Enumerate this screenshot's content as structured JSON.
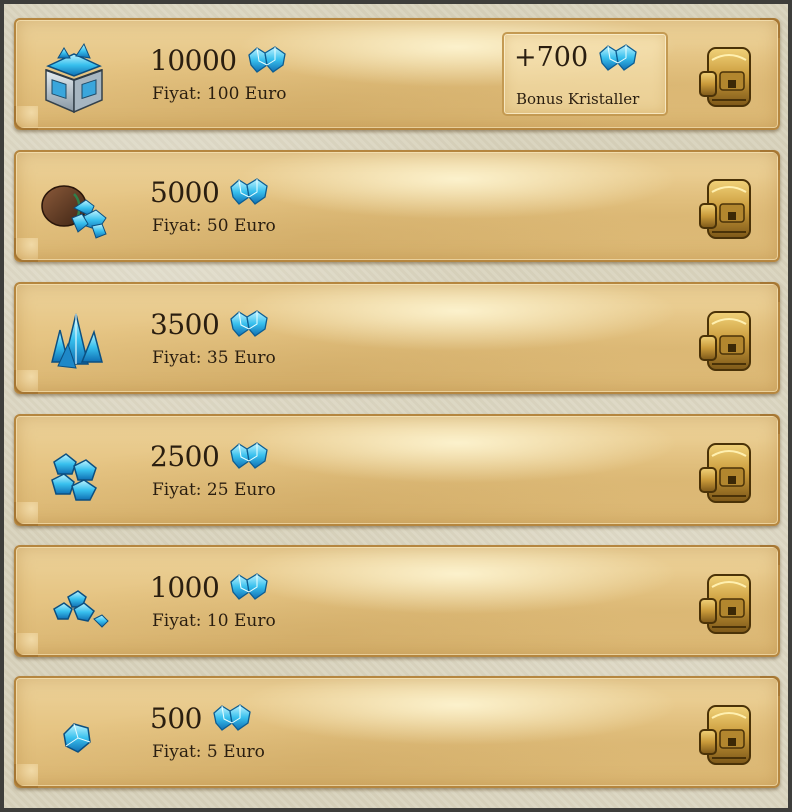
{
  "colors": {
    "panel": "#e6c584",
    "panel_border": "#b5863f",
    "text": "#2a1e10",
    "crystal": "#2aa8e8",
    "gold": "#c99a3a"
  },
  "currency_icon": "crystal-icon",
  "buy_icon": "gold-backpack-icon",
  "offers": [
    {
      "amount": "10000",
      "price": "Fiyat: 100 Euro",
      "item_icon": "treasure-chest-icon",
      "bonus": {
        "amount": "+700",
        "label": "Bonus Kristaller"
      }
    },
    {
      "amount": "5000",
      "price": "Fiyat: 50 Euro",
      "item_icon": "crystal-sack-icon"
    },
    {
      "amount": "3500",
      "price": "Fiyat: 35 Euro",
      "item_icon": "crystal-cluster-icon"
    },
    {
      "amount": "2500",
      "price": "Fiyat: 25 Euro",
      "item_icon": "crystal-pile-icon"
    },
    {
      "amount": "1000",
      "price": "Fiyat: 10 Euro",
      "item_icon": "small-crystal-pile-icon"
    },
    {
      "amount": "500",
      "price": "Fiyat: 5 Euro",
      "item_icon": "single-gem-icon"
    }
  ]
}
